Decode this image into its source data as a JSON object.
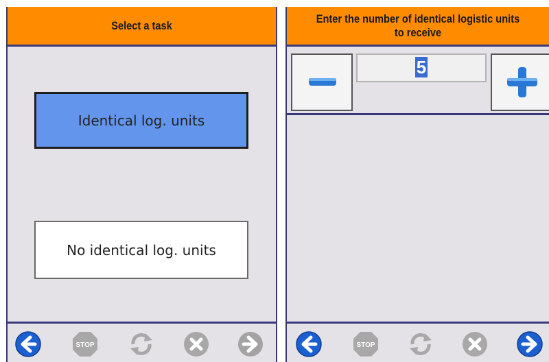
{
  "left_screen": {
    "title": "Select a task",
    "options": [
      {
        "label": "Identical log. units",
        "selected": true
      },
      {
        "label": "No identical log. units",
        "selected": false
      }
    ]
  },
  "right_screen": {
    "title": "Enter the number of identical logistic units to receive",
    "quantity": "5"
  },
  "footer": {
    "back_icon": "arrow-left-icon",
    "stop_label": "STOP",
    "refresh_icon": "refresh-icon",
    "cancel_icon": "cancel-icon",
    "next_icon": "arrow-right-icon"
  },
  "colors": {
    "header": "#ff8c00",
    "selected_button": "#6495ed",
    "screen_background": "#e4e2e6",
    "active_nav": "#1c5fd0",
    "disabled_nav": "#a3a3a3"
  }
}
